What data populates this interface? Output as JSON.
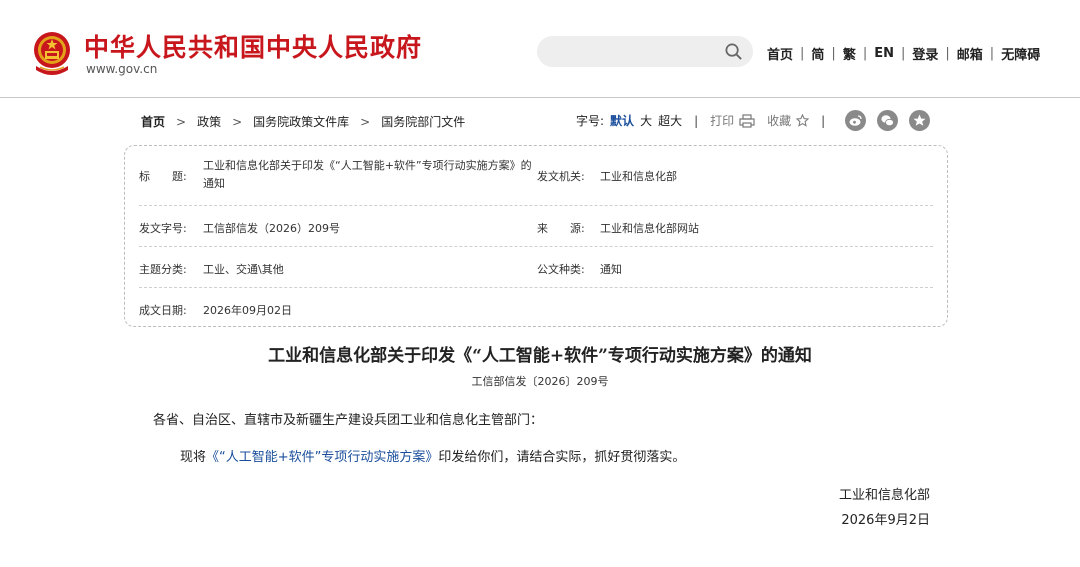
{
  "header": {
    "site_title": "中华人民共和国中央人民政府",
    "site_url": "www.gov.cn",
    "search": {
      "placeholder": ""
    },
    "nav": [
      "首页",
      "简",
      "繁",
      "EN",
      "登录",
      "邮箱",
      "无障碍"
    ]
  },
  "breadcrumb": [
    "首页",
    "政策",
    "国务院政策文件库",
    "国务院部门文件"
  ],
  "tools": {
    "font_label": "字号:",
    "sizes": [
      "默认",
      "大",
      "超大"
    ],
    "print_label": "打印",
    "favorite_label": "收藏"
  },
  "meta": {
    "title_label": "标　　题:",
    "title_value": "工业和信息化部关于印发《“人工智能+软件”专项行动实施方案》的通知",
    "issuer_label": "发文机关:",
    "issuer_value": "工业和信息化部",
    "doc_no_label": "发文字号:",
    "doc_no_value": "工信部信发（2026）209号",
    "source_label": "来　　源:",
    "source_value": "工业和信息化部网站",
    "category_label": "主题分类:",
    "category_value": "工业、交通\\其他",
    "doc_type_label": "公文种类:",
    "doc_type_value": "通知",
    "date_label": "成文日期:",
    "date_value": "2026年09月02日"
  },
  "article": {
    "title": "工业和信息化部关于印发《“人工智能+软件”专项行动实施方案》的通知",
    "doc_no": "工信部信发〔2026〕209号",
    "para1": "各省、自治区、直辖市及新疆生产建设兵团工业和信息化主管部门：",
    "para2_prefix": "现将",
    "para2_link": "《“人工智能+软件”专项行动实施方案》",
    "para2_suffix": "印发给你们，请结合实际，抓好贯彻落实。",
    "sign_org": "工业和信息化部",
    "sign_date": "2026年9月2日"
  },
  "colors": {
    "brand_red": "#c8161d",
    "link_blue": "#1a4e9b",
    "share_gray": "#8a8a8a"
  }
}
